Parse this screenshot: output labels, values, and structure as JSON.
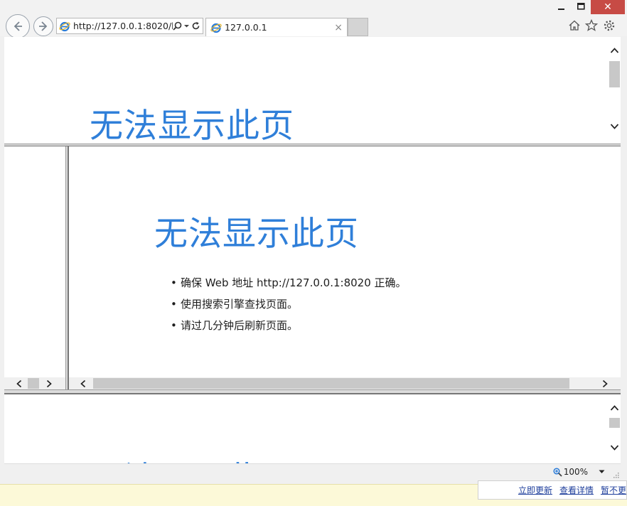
{
  "browser": {
    "address": "http://127.0.0.1:8020/h",
    "tab_title": "127.0.0.1",
    "tab_close": "×",
    "close_glyph": "✕",
    "zoom": "100%"
  },
  "error": {
    "heading": "无法显示此页",
    "tips": [
      "确保 Web 地址 http://127.0.0.1:8020 正确。",
      "使用搜索引擎查找页面。",
      "请过几分钟后刷新页面。"
    ]
  },
  "notification": {
    "links": [
      "立即更新",
      "查看详情",
      "暂不更"
    ]
  },
  "colors": {
    "heading": "#2f7fd9",
    "close_button": "#c74b45",
    "notification_bar": "#fcf9d8"
  }
}
